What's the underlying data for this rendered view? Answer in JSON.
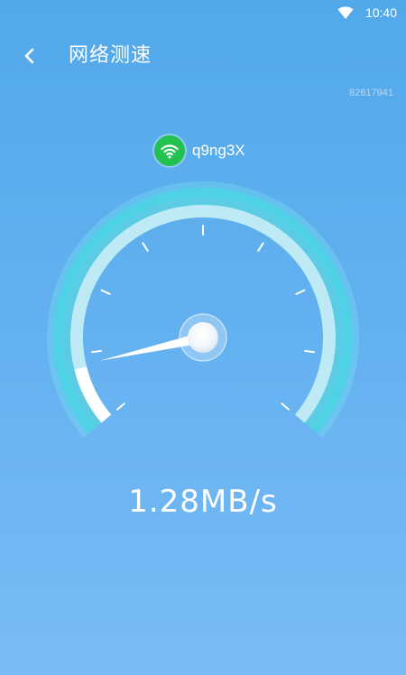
{
  "status_bar": {
    "time": "10:40",
    "wifi_icon": "wifi-signal-icon"
  },
  "header": {
    "back_icon": "chevron-left-icon",
    "title": "网络测速"
  },
  "device_id": "82617941",
  "network": {
    "icon": "wifi-icon",
    "name": "q9ng3X"
  },
  "gauge": {
    "reading_fraction": 0.1,
    "tick_count": 9
  },
  "speed": "1.28MB/s",
  "colors": {
    "background_top": "#52a9ea",
    "background_bottom": "#78bcf6",
    "gauge_outer": "#4fd2e6",
    "gauge_track": "#cfeef9",
    "wifi_badge": "#21c24f"
  }
}
